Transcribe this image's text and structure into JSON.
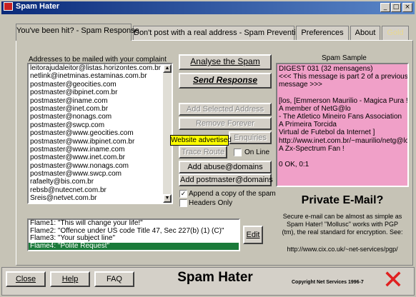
{
  "window": {
    "title": "Spam Hater",
    "controls": [
      "_",
      "□",
      "×"
    ]
  },
  "tabs": [
    "You've been hit? - Spam Response",
    "Don't post with a real address - Spam Prevention",
    "Preferences",
    "About",
    "Gold"
  ],
  "addresses_label": "Addresses to be mailed with your complaint",
  "addresses": [
    "leitorajudaleitor@listas.horizontes.com.br",
    "netlink@inetminas.estaminas.com.br",
    "postmaster@geocities.com",
    "postmaster@ibpinet.com.br",
    "postmaster@iname.com",
    "postmaster@inet.com.br",
    "postmaster@nonags.com",
    "postmaster@swcp.com",
    "postmaster@www.geocities.com",
    "postmaster@www.ibpinet.com.br",
    "postmaster@www.iname.com",
    "postmaster@www.inet.com.br",
    "postmaster@www.nonags.com",
    "postmaster@www.swcp.com",
    "rafaelty@bis.com.br",
    "rebsb@nutecnet.com.br",
    "Sreis@netvet.com.br"
  ],
  "buttons": {
    "analyse": "Analyse the Spam",
    "send": "Send Response",
    "add_selected": "Add Selected Address",
    "remove_forever": "Remove Forever",
    "enquiries": "Enquiries",
    "trace_route": "Trace Route",
    "add_abuse": "Add abuse@domains",
    "add_postmaster": "Add postmaster@domains",
    "edit": "Edit",
    "close": "Close",
    "help": "Help",
    "faq": "FAQ"
  },
  "tooltip": "Website advertised",
  "checkboxes": {
    "on_line": {
      "label": "On Line",
      "checked": false
    },
    "append_copy": {
      "label": "Append a copy of the spam",
      "checked": true
    },
    "headers_only": {
      "label": "Headers Only",
      "checked": false
    }
  },
  "spam_sample_label": "Spam Sample",
  "spam_sample_lines": [
    "DIGEST 031 (32 mensagens)",
    "<<< This message is part 2 of a previous",
    "message >>>",
    "",
    "[los, [Emmerson Maurilio - Magica Pura !!!",
    "    A member of NetG@lo",
    "- The Atletico Mineiro Fans Association",
    "    A Primeira Torcida",
    "Virtual de Futebol da Internet ]",
    "http://www.inet.com.br/~maurilio/netg@lo",
    "    A Zx-Spectrum Fan !",
    "",
    "0 OK, 0:1"
  ],
  "flames": [
    "Flame1: \"This will change your life!\"",
    "Flame2: \"Offence under US code Title 47, Sec 227(b) (1) (C)\"",
    "Flame3: \"Your subject line\"",
    "Flame4: \"Polite Request\""
  ],
  "flames_selected_index": 3,
  "private_email": {
    "heading": "Private E-Mail?",
    "text_lines": [
      "Secure e-mail can be almost as simple as",
      "Spam Hater! \"Mollusc\" works with PGP",
      "(tm), the real standard for encryption. See:"
    ],
    "url": "http://www.cix.co.uk/~net-services/pgp/"
  },
  "footer": {
    "app_name": "Spam Hater",
    "copyright": "Copyright Net Services 1996-7"
  },
  "colors": {
    "title_bar": "#0a2a7a",
    "selected_row": "#1a7a3a",
    "sample_bg": "#f0a0c8",
    "tooltip_bg": "#ffff00",
    "logo_x": "#e02020"
  }
}
